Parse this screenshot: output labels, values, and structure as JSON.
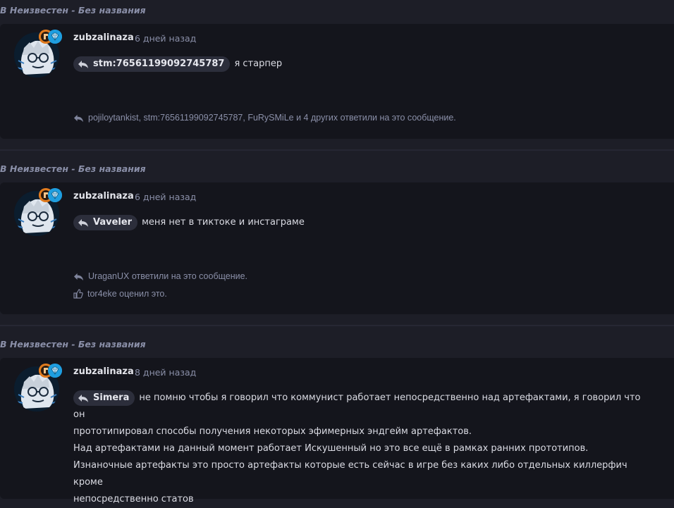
{
  "posts": [
    {
      "header_prefix": "В",
      "header_text": "Неизвестен - Без названия",
      "author": "zubzalinaza",
      "time": "6 дней назад",
      "quote_name": "stm:76561199092745787",
      "message_lines": [
        "я старпер"
      ],
      "replies_text": "pojiloytankist, stm:76561199092745787, FuRySMiLe и 4 других ответили на это сообщение."
    },
    {
      "header_prefix": "В",
      "header_text": "Неизвестен - Без названия",
      "author": "zubzalinaza",
      "time": "6 дней назад",
      "quote_name": "Vaveler",
      "message_lines": [
        "меня нет в тиктоке и инстаграме"
      ],
      "replies_text": "UraganUX ответили на это сообщение.",
      "likes_text": "tor4eke оценил это."
    },
    {
      "header_prefix": "В",
      "header_text": "Неизвестен - Без названия",
      "author": "zubzalinaza",
      "time": "8 дней назад",
      "quote_name": "Simera",
      "message_lines": [
        "не помню чтобы я говорил что коммунист работает непосредственно над артефактами, я говорил что он",
        "прототипировал способы получения некоторых эфимерных эндгейм артефактов.",
        "Над артефактами на данный момент работает Искушенный но это все ещё в рамках ранних прототипов.",
        "Изнаночные артефакты это просто артефакты которые есть сейчас в игре без каких либо отдельных киллерфич кроме",
        "непосредственно статов"
      ]
    }
  ],
  "colors": {
    "badge_orange": "#e07b1e",
    "badge_blue": "#1e9ee0",
    "card_bg": "#14151c",
    "page_bg": "#1d1e27"
  },
  "icons": {
    "reply": "reply-arrow-icon",
    "like": "thumbs-up-icon",
    "badge1": "rank-badge-icon",
    "badge2": "diamond-badge-icon"
  }
}
